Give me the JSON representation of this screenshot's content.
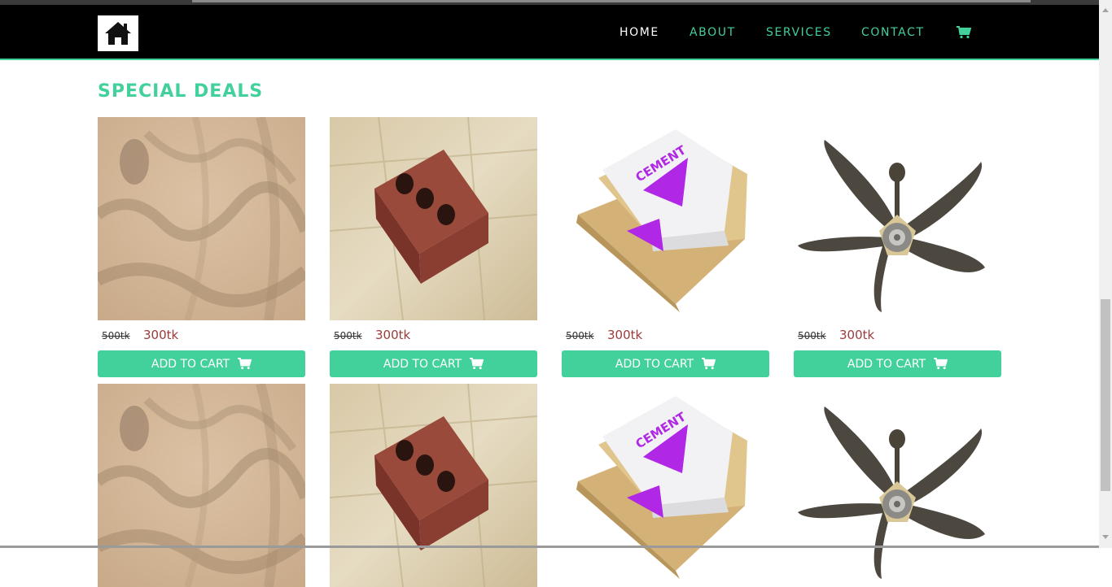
{
  "nav": {
    "home": "HOME",
    "about": "ABOUT",
    "services": "SERVICES",
    "contact": "CONTACT",
    "cart_icon": "shopping-cart-icon",
    "logo_icon": "home-icon"
  },
  "section": {
    "title": "SPECIAL DEALS"
  },
  "products": [
    {
      "image": "sand",
      "old_price": "500tk",
      "new_price": "300tk",
      "button": "ADD TO CART"
    },
    {
      "image": "brick",
      "old_price": "500tk",
      "new_price": "300tk",
      "button": "ADD TO CART"
    },
    {
      "image": "cement-bags",
      "old_price": "500tk",
      "new_price": "300tk",
      "button": "ADD TO CART"
    },
    {
      "image": "ceiling-fan",
      "old_price": "500tk",
      "new_price": "300tk",
      "button": "ADD TO CART"
    },
    {
      "image": "sand",
      "old_price": "",
      "new_price": "",
      "button": ""
    },
    {
      "image": "brick",
      "old_price": "",
      "new_price": "",
      "button": ""
    },
    {
      "image": "cement-bags",
      "old_price": "",
      "new_price": "",
      "button": ""
    },
    {
      "image": "ceiling-fan",
      "old_price": "",
      "new_price": "",
      "button": ""
    }
  ],
  "colors": {
    "accent": "#42d09b",
    "navbar": "#000000",
    "price": "#9b3b3b"
  }
}
